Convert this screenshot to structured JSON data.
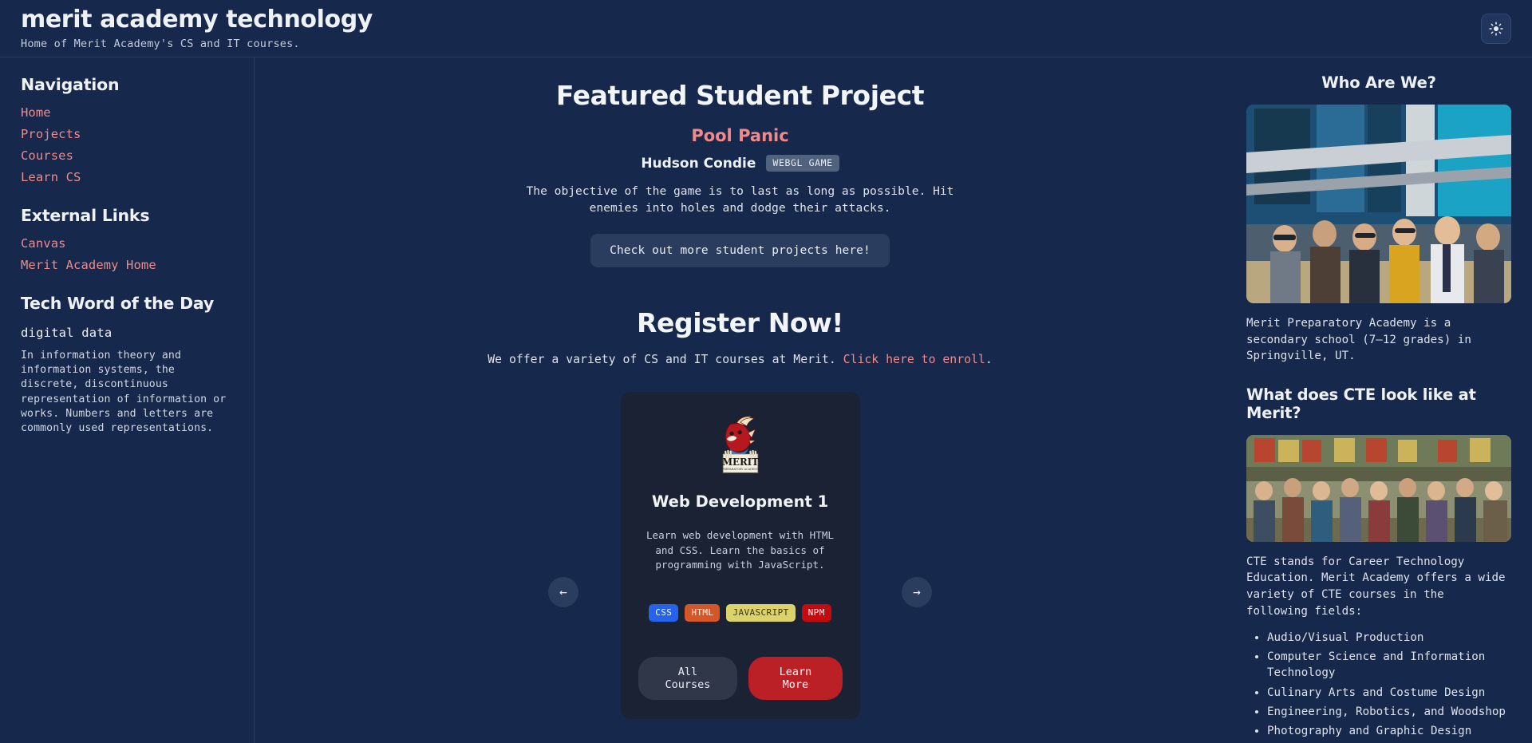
{
  "header": {
    "title": "merit academy technology",
    "tagline": "Home of Merit Academy's CS and IT courses.",
    "theme_toggle_icon": "sun-icon"
  },
  "sidebar_left": {
    "nav_heading": "Navigation",
    "nav_items": [
      {
        "label": "Home"
      },
      {
        "label": "Projects"
      },
      {
        "label": "Courses"
      },
      {
        "label": "Learn CS"
      }
    ],
    "external_heading": "External Links",
    "external_items": [
      {
        "label": "Canvas"
      },
      {
        "label": "Merit Academy Home"
      }
    ],
    "word_heading": "Tech Word of the Day",
    "word_term": "digital data",
    "word_definition": "In information theory and information systems, the discrete, discontinuous representation of information or works. Numbers and letters are commonly used representations."
  },
  "main": {
    "featured_title": "Featured Student Project",
    "project_name": "Pool Panic",
    "project_author": "Hudson Condie",
    "project_badge": "WEBGL GAME",
    "project_description": "The objective of the game is to last as long as possible. Hit enemies into holes and dodge their attacks.",
    "projects_button": "Check out more student projects here!",
    "register_title": "Register Now!",
    "register_text_before": "We offer a variety of CS and IT courses at Merit. ",
    "register_link": "Click here to enroll",
    "register_text_after": ".",
    "carousel": {
      "prev_icon": "arrow-left-icon",
      "prev_label": "←",
      "next_icon": "arrow-right-icon",
      "next_label": "→"
    },
    "course_card": {
      "logo_alt": "merit-dragon-logo",
      "title": "Web Development 1",
      "description": "Learn web development with HTML and CSS. Learn the basics of programming with JavaScript.",
      "tags": [
        {
          "label": "CSS",
          "bg": "#2563eb",
          "fg": "#ffffff"
        },
        {
          "label": "HTML",
          "bg": "#d4572a",
          "fg": "#ffffff"
        },
        {
          "label": "JAVASCRIPT",
          "bg": "#dbd26a",
          "fg": "#3a3518"
        },
        {
          "label": "NPM",
          "bg": "#c30b10",
          "fg": "#ffffff"
        }
      ],
      "all_courses_button": "All Courses",
      "learn_more_button": "Learn More"
    }
  },
  "sidebar_right": {
    "who_heading": "Who Are We?",
    "who_photo_alt": "students-in-front-of-school-building",
    "who_text": "Merit Preparatory Academy is a secondary school (7–12 grades) in Springville, UT.",
    "cte_heading": "What does CTE look like at Merit?",
    "cte_photo_alt": "class-group-photo-in-classroom",
    "cte_text": "CTE stands for Career Technology Education. Merit Academy offers a wide variety of CTE courses in the following fields:",
    "cte_list": [
      "Audio/Visual Production",
      "Computer Science and Information Technology",
      "Culinary Arts and Costume Design",
      "Engineering, Robotics, and Woodshop",
      "Photography and Graphic Design"
    ]
  },
  "colors": {
    "page_bg": "#16284b",
    "card_bg": "#1b2234",
    "link": "#f08a8a",
    "accent_red": "#bb2026",
    "border": "#2b3d60"
  }
}
